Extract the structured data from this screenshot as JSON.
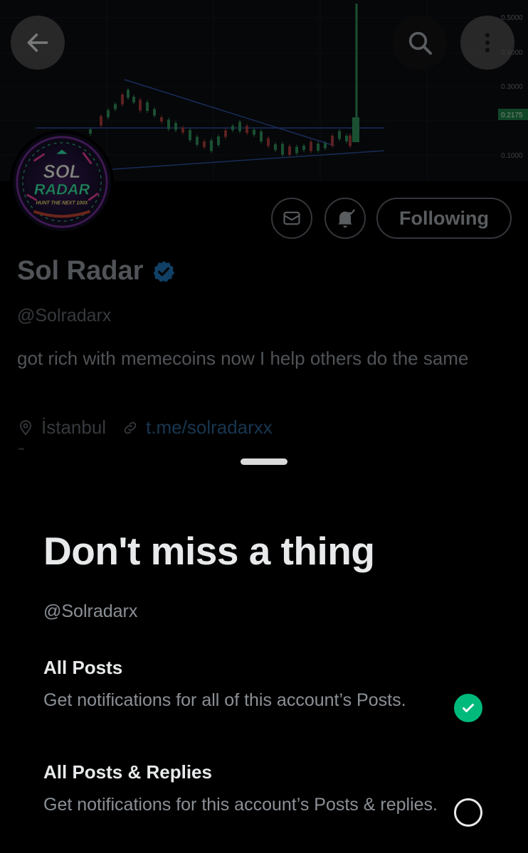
{
  "banner": {
    "axis_labels": [
      "0.5000",
      "0.4000",
      "0.3000",
      "0.2175",
      "0.1000"
    ],
    "price_highlight_color": "#1e7a45"
  },
  "nav": {
    "back_icon": "arrow-left-icon",
    "search_icon": "search-icon",
    "more_icon": "more-vertical-icon"
  },
  "profile": {
    "avatar_text": [
      "SOL",
      "RADAR"
    ],
    "avatar_tagline": "HUNT THE NEXT 100X",
    "name": "Sol Radar",
    "verified_color": "#1d9bf0",
    "handle": "@Solradarx",
    "bio": "got rich with memecoins now I help others do the same",
    "location": "İstanbul",
    "link": "t.me/solradarxx",
    "following_label": "Following"
  },
  "sheet": {
    "title": "Don't miss a thing",
    "handle": "@Solradarx",
    "options": [
      {
        "title": "All Posts",
        "description": "Get notifications for all of this account’s Posts.",
        "selected": true
      },
      {
        "title": "All Posts & Replies",
        "description": "Get notifications for this account’s Posts & replies.",
        "selected": false
      }
    ],
    "accent_color": "#00ba7c"
  }
}
